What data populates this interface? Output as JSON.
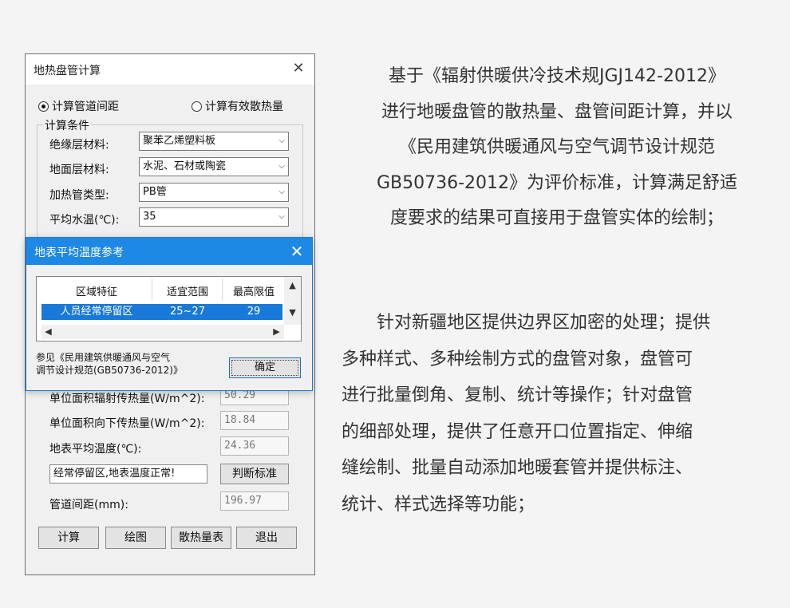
{
  "main_window": {
    "title": "地热盘管计算",
    "close_glyph": "✕",
    "radio_spacing": "计算管道间距",
    "radio_heat": "计算有效散热量",
    "group_label": "计算条件",
    "insulation_label": "绝缘层材料:",
    "insulation_value": "聚苯乙烯塑料板",
    "surface_label": "地面层材料:",
    "surface_value": "水泥、石材或陶瓷",
    "pipe_type_label": "加热管类型:",
    "pipe_type_value": "PB管",
    "water_temp_label": "平均水温(℃):",
    "water_temp_value": "35",
    "radiant_label": "单位面积辐射传热量(W/m^2):",
    "radiant_value": "50.29",
    "downward_label": "单位面积向下传热量(W/m^2):",
    "downward_value": "18.84",
    "surface_temp_label": "地表平均温度(℃):",
    "surface_temp_value": "24.36",
    "status_text": "经常停留区,地表温度正常!",
    "judge_button": "判断标准",
    "spacing_label": "管道间距(mm):",
    "spacing_value": "196.97",
    "buttons": {
      "calc": "计算",
      "draw": "绘图",
      "table": "散热量表",
      "exit": "退出"
    }
  },
  "popup": {
    "title": "地表平均温度参考",
    "close_glyph": "✕",
    "columns": [
      "区域特征",
      "适宜范围",
      "最高限值"
    ],
    "row": [
      "人员经常停留区",
      "25~27",
      "29"
    ],
    "note_line1": "参见《民用建筑供暖通风与空气",
    "note_line2": "调节设计规范(GB50736-2012)》",
    "ok_button": "确定"
  },
  "description": {
    "para1": [
      "基于《辐射供暖供冷技术规JGJ142-2012》",
      "进行地暖盘管的散热量、盘管间距计算，并以",
      "《民用建筑供暖通风与空气调节设计规范",
      "GB50736-2012》为评价标准，计算满足舒适",
      "度要求的结果可直接用于盘管实体的绘制；"
    ],
    "para2": [
      "　　针对新疆地区提供边界区加密的处理；提供",
      "多种样式、多种绘制方式的盘管对象，盘管可",
      "进行批量倒角、复制、统计等操作；针对盘管",
      "的细部处理，提供了任意开口位置指定、伸缩",
      "缝绘制、批量自动添加地暖套管并提供标注、",
      "统计、样式选择等功能；"
    ]
  },
  "icons": {
    "combo_arrow": "chevron-down-icon",
    "scroll_up": "chevron-up-icon",
    "scroll_down": "chevron-down-icon",
    "scroll_left": "chevron-left-icon",
    "scroll_right": "chevron-right-icon"
  },
  "colors": {
    "title_blue": "#1e88e5",
    "selection_blue": "#1979d8"
  }
}
